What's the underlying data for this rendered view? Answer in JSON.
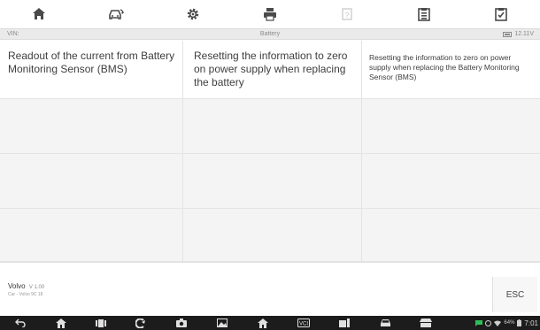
{
  "toolbar": {
    "buttons": [
      {
        "icon": "home-icon"
      },
      {
        "icon": "vehicle-swap-icon"
      },
      {
        "icon": "settings-icon"
      },
      {
        "icon": "print-icon"
      },
      {
        "icon": "help-icon"
      },
      {
        "icon": "save-icon"
      },
      {
        "icon": "data-logging-icon"
      }
    ]
  },
  "infobar": {
    "vin_label": "VIN:",
    "title": "Battery",
    "voltage": "12.11V"
  },
  "table": {
    "headers": [
      "Readout of the current from Battery Monitoring Sensor (BMS)",
      "Resetting the information to zero on power supply when replacing the battery",
      "Resetting the information to zero on power supply when replacing the Battery Monitoring Sensor (BMS)"
    ]
  },
  "footer": {
    "vehicle_make": "Volvo",
    "version": "V 1.00",
    "vehicle_sub": "Car - Volvo 9C 18",
    "esc_label": "ESC"
  },
  "system_bar": {
    "battery_pct": "64%",
    "time": "7:01"
  },
  "colors": {
    "toolbar_icon": "#4a4a4a",
    "grid_cell": "#f4f4f4",
    "nav_bg": "#1c1c1c"
  }
}
